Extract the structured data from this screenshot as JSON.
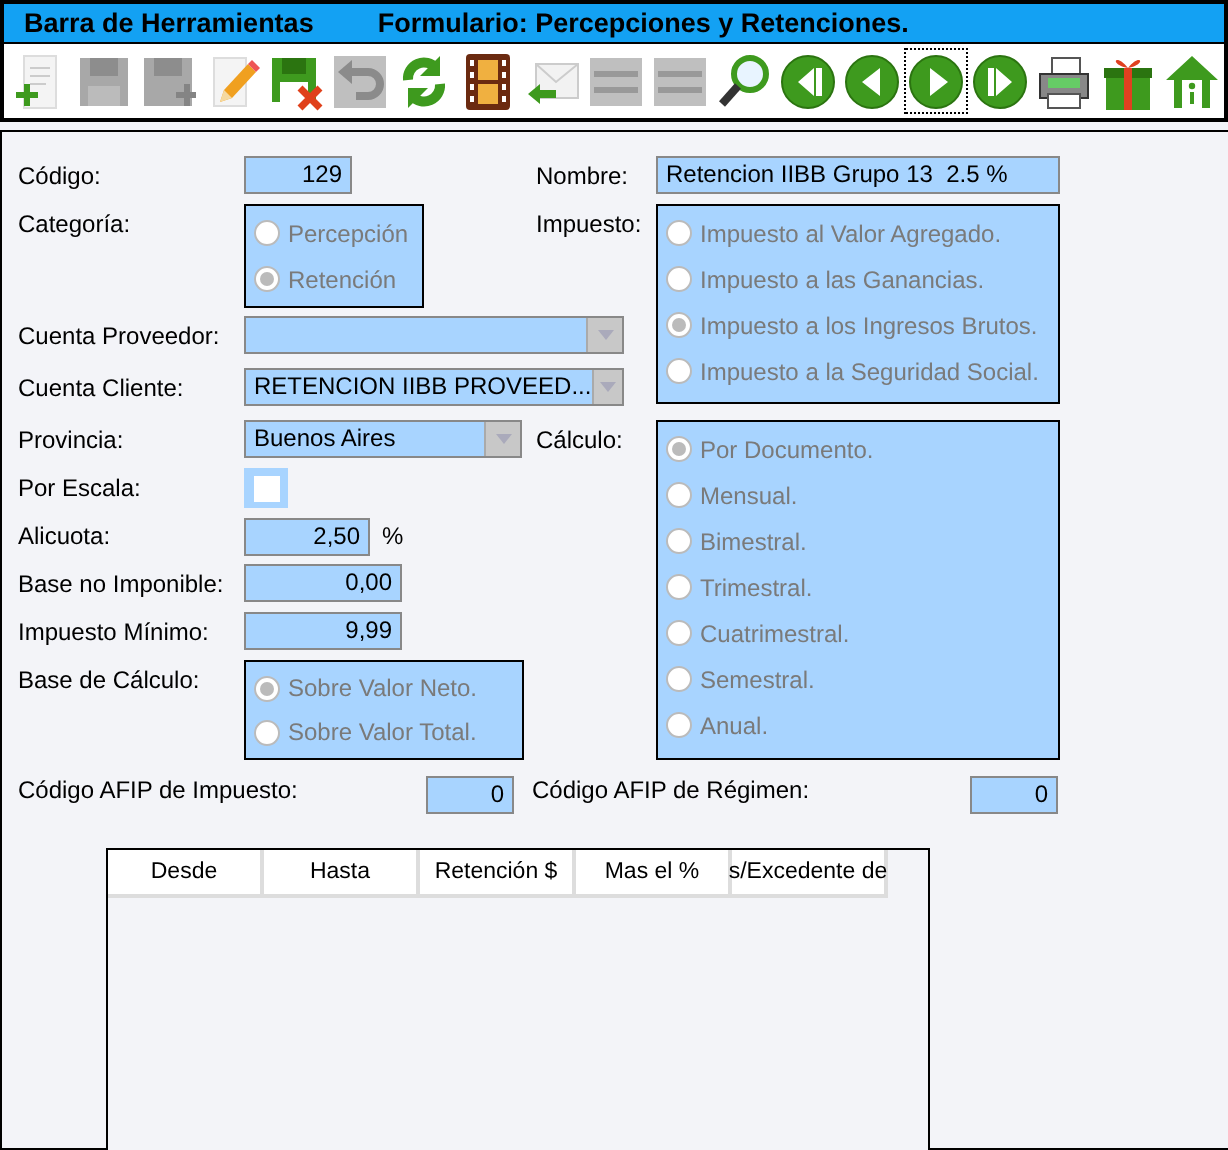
{
  "toolbar": {
    "title": "Barra de Herramientas",
    "subtitle": "Formulario: Percepciones y Retenciones.",
    "buttons": [
      {
        "kind": "new",
        "disabled": false
      },
      {
        "kind": "save",
        "disabled": true
      },
      {
        "kind": "save-as",
        "disabled": true
      },
      {
        "kind": "edit",
        "disabled": false
      },
      {
        "kind": "cancel",
        "disabled": false
      },
      {
        "kind": "undo",
        "disabled": true
      },
      {
        "kind": "refresh",
        "disabled": false
      },
      {
        "kind": "film",
        "disabled": false
      },
      {
        "kind": "import",
        "disabled": false
      },
      {
        "kind": "list",
        "disabled": true
      },
      {
        "kind": "list",
        "disabled": true
      },
      {
        "kind": "search",
        "disabled": false
      },
      {
        "kind": "first",
        "disabled": false
      },
      {
        "kind": "previous",
        "disabled": false
      },
      {
        "kind": "next",
        "disabled": false,
        "focused": true
      },
      {
        "kind": "last",
        "disabled": false
      },
      {
        "kind": "print",
        "disabled": false
      },
      {
        "kind": "gift",
        "disabled": false
      },
      {
        "kind": "home",
        "disabled": false
      }
    ]
  },
  "form": {
    "codigo": {
      "label": "Código:",
      "value": "129"
    },
    "nombre": {
      "label": "Nombre:",
      "value": "Retencion IIBB Grupo 13  2.5 %"
    },
    "categoria": {
      "label": "Categoría:",
      "disabled": true,
      "options": [
        {
          "label": "Percepción",
          "selected": false
        },
        {
          "label": "Retención",
          "selected": true
        }
      ]
    },
    "impuesto": {
      "label": "Impuesto:",
      "disabled": true,
      "options": [
        {
          "label": "Impuesto al Valor Agregado.",
          "selected": false
        },
        {
          "label": "Impuesto a las Ganancias.",
          "selected": false
        },
        {
          "label": "Impuesto a los Ingresos Brutos.",
          "selected": true
        },
        {
          "label": "Impuesto a la Seguridad Social.",
          "selected": false
        }
      ]
    },
    "cuenta_proveedor": {
      "label": "Cuenta Proveedor:"
    },
    "cuenta_cliente": {
      "label": "Cuenta Cliente:",
      "value": "RETENCION IIBB PROVEED..."
    },
    "provincia": {
      "label": "Provincia:",
      "value": "Buenos Aires"
    },
    "calculo": {
      "label": "Cálculo:",
      "disabled": true,
      "options": [
        {
          "label": "Por Documento.",
          "selected": true
        },
        {
          "label": "Mensual.",
          "selected": false
        },
        {
          "label": "Bimestral.",
          "selected": false
        },
        {
          "label": "Trimestral.",
          "selected": false
        },
        {
          "label": "Cuatrimestral.",
          "selected": false
        },
        {
          "label": "Semestral.",
          "selected": false
        },
        {
          "label": "Anual.",
          "selected": false
        }
      ]
    },
    "por_escala": {
      "label": "Por Escala:",
      "checked": false
    },
    "alicuota": {
      "label": "Alicuota:",
      "value": "2,50",
      "unit": "%"
    },
    "base_no_imponible": {
      "label": "Base no Imponible:",
      "value": "0,00"
    },
    "impuesto_minimo": {
      "label": "Impuesto Mínimo:",
      "value": "9,99"
    },
    "base_calculo": {
      "label": "Base de Cálculo:",
      "disabled": true,
      "options": [
        {
          "label": "Sobre Valor Neto.",
          "selected": true
        },
        {
          "label": "Sobre Valor Total.",
          "selected": false
        }
      ]
    },
    "afip_impuesto": {
      "label": "Código AFIP de Impuesto:",
      "value": "0"
    },
    "afip_regimen": {
      "label": "Código AFIP de Régimen:",
      "value": "0"
    }
  },
  "table": {
    "columns": [
      "Desde",
      "Hasta",
      "Retención $",
      "Mas el %",
      "s/Excedente de"
    ]
  }
}
